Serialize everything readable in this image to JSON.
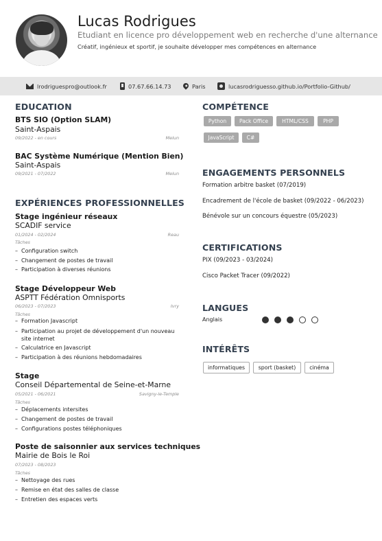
{
  "header": {
    "name": "Lucas Rodrigues",
    "subtitle": "Etudiant en licence pro développement web en recherche d'une alternance",
    "tagline": "Créatif, ingénieux et sportif, je souhaite développer mes compétences en alternance"
  },
  "contact": {
    "email": "lrodriguespro@outlook.fr",
    "phone": "07.67.66.14.73",
    "city": "Paris",
    "website": "lucasrodriguesso.github.io/Portfolio-Github/",
    "icons": [
      "mail-icon",
      "phone-icon",
      "location-pin-icon",
      "github-icon"
    ]
  },
  "education": {
    "title": "EDUCATION",
    "items": [
      {
        "degree": "BTS SIO (Option SLAM)",
        "school": "Saint-Aspais",
        "dates": "09/2022 - en cours",
        "location": "Melun"
      },
      {
        "degree": "BAC Système Numérique (Mention Bien)",
        "school": "Saint-Aspais",
        "dates": "09/2021 - 07/2022",
        "location": "Melun"
      }
    ]
  },
  "experience": {
    "title": "EXPÉRIENCES PROFESSIONNELLES",
    "tasks_label": "Tâches",
    "items": [
      {
        "role": "Stage ingénieur réseaux",
        "company": "SCADIF service",
        "dates": "01/2024 - 02/2024",
        "location": "Reau",
        "tasks": [
          "Configuration switch",
          "Changement de postes de travail",
          "Participation à diverses réunions"
        ]
      },
      {
        "role": "Stage Développeur Web",
        "company": "ASPTT Fédération Omnisports",
        "dates": "06/2023 - 07/2023",
        "location": "Ivry",
        "tasks": [
          "Formation Javascript",
          "Participation au projet de développement d'un nouveau site internet",
          "Calculatrice en Javascript",
          "Participation à des réunions hebdomadaires"
        ]
      },
      {
        "role": "Stage",
        "company": "Conseil Départemental de Seine-et-Marne",
        "dates": "05/2021 - 06/2021",
        "location": "Savigny-le-Temple",
        "tasks": [
          "Déplacements intersites",
          "Changement de postes de travail",
          "Configurations postes téléphoniques"
        ]
      },
      {
        "role": "Poste de saisonnier aux services techniques",
        "company": "Mairie de Bois le Roi",
        "dates": "07/2023 - 08/2023",
        "location": "",
        "tasks": [
          "Nettoyage des rues",
          "Remise en état des salles de classe",
          "Entretien des espaces verts"
        ]
      }
    ]
  },
  "skills": {
    "title": "COMPÉTENCE",
    "items": [
      "Python",
      "Pack Office",
      "HTML/CSS",
      "PHP",
      "JavaScript",
      "C#"
    ]
  },
  "engagements": {
    "title": "ENGAGEMENTS PERSONNELS",
    "items": [
      "Formation arbitre basket (07/2019)",
      "Encadrement de l'école de basket (09/2022 - 06/2023)",
      "Bénévole sur un concours équestre (05/2023)"
    ]
  },
  "certifications": {
    "title": "CERTIFICATIONS",
    "items": [
      "PIX (09/2023 - 03/2024)",
      "Cisco Packet Tracer (09/2022)"
    ]
  },
  "languages": {
    "title": "LANGUES",
    "items": [
      {
        "name": "Anglais",
        "level": 3,
        "max": 5
      }
    ]
  },
  "interests": {
    "title": "INTÉRÊTS",
    "items": [
      "informatiques",
      "sport (basket)",
      "cinéma"
    ]
  }
}
